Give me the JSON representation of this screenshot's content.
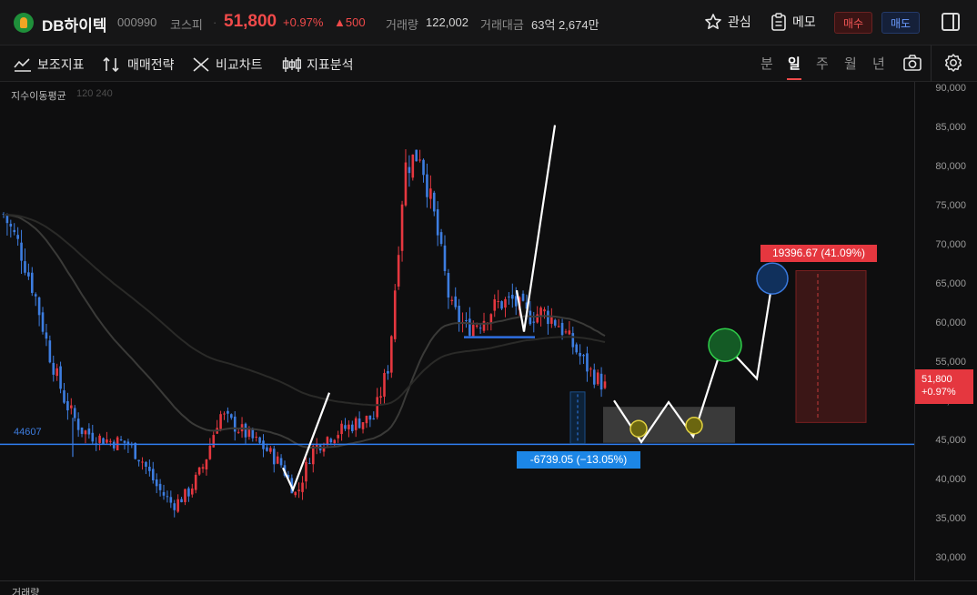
{
  "header": {
    "stock_name": "DB하이텍",
    "stock_code": "000990",
    "market": "코스피",
    "separator": "·",
    "price": "51,800",
    "change_pct": "+0.97%",
    "change_amt": "▲500",
    "volume_label": "거래량",
    "volume_value": "122,002",
    "amount_label": "거래대금",
    "amount_value": "63억 2,674만",
    "watch_label": "관심",
    "memo_label": "메모",
    "buy_label": "매수",
    "sell_label": "매도"
  },
  "toolbar": {
    "tools": [
      "보조지표",
      "매매전략",
      "비교차트",
      "지표분석"
    ],
    "periods": [
      "분",
      "일",
      "주",
      "월",
      "년"
    ],
    "active_period": "일"
  },
  "chart": {
    "indicator_label": "지수이동평균",
    "indicator_params": "120 240",
    "support_level_label": "44607",
    "current_price_tag": [
      "51,800",
      "+0.97%"
    ],
    "measure_up_label": "19396.67  (41.09%)",
    "measure_down_label": "-6739.05  (−13.05%)",
    "volume_label": "거래량",
    "colors": {
      "up": "#e5373f",
      "down": "#3d7de0",
      "support": "#2f7df0",
      "annotation": "#ffffff"
    }
  },
  "chart_data": {
    "type": "candlestick",
    "title": "",
    "ylim": [
      27500,
      91500
    ],
    "yticks": [
      "90,000",
      "85,000",
      "80,000",
      "75,000",
      "70,000",
      "65,000",
      "60,000",
      "55,000",
      "50,000",
      "45,000",
      "40,000",
      "35,000",
      "30,000"
    ],
    "support_level": 44607,
    "last_price": 51800,
    "series": [
      {
        "name": "지수이동평균 120",
        "values": []
      },
      {
        "name": "지수이동평균 240",
        "values": []
      }
    ],
    "approx_close_path": [
      74000,
      70000,
      64000,
      56000,
      50000,
      46500,
      45500,
      45000,
      44800,
      42500,
      39000,
      36800,
      38500,
      42000,
      48500,
      47000,
      45500,
      44000,
      42000,
      38000,
      44000,
      45500,
      46500,
      47500,
      48000,
      55000,
      80000,
      82000,
      73000,
      62000,
      59500,
      60500,
      62500,
      63000,
      61000,
      61500,
      60000,
      57000,
      54000,
      52000
    ]
  }
}
